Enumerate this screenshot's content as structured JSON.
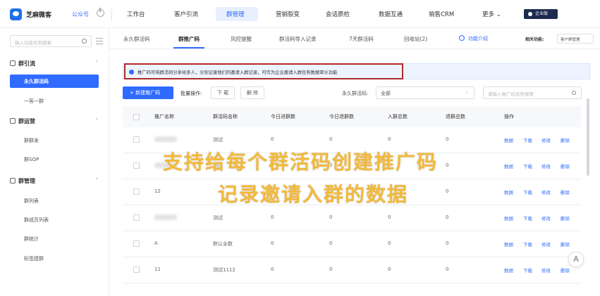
{
  "brand": {
    "name": "芝麻微客",
    "account": "公众号"
  },
  "topnav": {
    "items": [
      "工作台",
      "客户引流",
      "群管理",
      "营销裂变",
      "会话质检",
      "数据互通",
      "销售CRM",
      "更多 ⌄"
    ],
    "active_index": 2,
    "corp_badge": "企业版"
  },
  "sidebar": {
    "search_placeholder": "输入功能名称搜索",
    "groups": [
      {
        "label": "群引流",
        "items": [
          "永久群活码",
          "一客一群"
        ]
      },
      {
        "label": "群运营",
        "items": [
          "群群发",
          "群SOP"
        ]
      },
      {
        "label": "群管理",
        "items": [
          "群列表",
          "群成员列表",
          "群统计",
          "标签建群"
        ]
      }
    ],
    "active_item": "永久群活码"
  },
  "subtabs": {
    "items": [
      "永久群活码",
      "群推广码",
      "风控提醒",
      "群活码导入记录",
      "7天群活码",
      "回收站(2)"
    ],
    "active_index": 1,
    "help": "功能介绍",
    "related_label": "相关功能:",
    "related_value": "客户群管理"
  },
  "notice": "推广码可将群活码分享给多人，分别记录他们的邀请入群记录，可作为企业邀请入群任务数据审计功能",
  "toolbar": {
    "new_button": "+ 新建推广码",
    "batch_label": "批量操作:",
    "download": "下 载",
    "delete": "删 除",
    "filter_label": "永久群活码:",
    "filter_value": "全部",
    "search_placeholder": "请输入推广码名称搜索"
  },
  "table": {
    "headers": [
      "推广名称",
      "群活码名称",
      "今日进群数",
      "今日退群数",
      "入群总数",
      "退群总数",
      "操作"
    ],
    "ops": [
      "数据",
      "下载",
      "修改",
      "删除"
    ],
    "rows": [
      {
        "name": "",
        "code": "测试",
        "today_in": "0",
        "today_out": "0",
        "total_in": "0",
        "total_out": "0",
        "blurred": true
      },
      {
        "name": "",
        "code": "测试",
        "today_in": "0",
        "today_out": "0",
        "total_in": "0",
        "total_out": "0",
        "blurred": true
      },
      {
        "name": "12",
        "code": "",
        "today_in": "",
        "today_out": "",
        "total_in": "",
        "total_out": "0",
        "blurred": false
      },
      {
        "name": "",
        "code": "测试",
        "today_in": "0",
        "today_out": "0",
        "total_in": "0",
        "total_out": "0",
        "blurred": true
      },
      {
        "name": "A",
        "code": "默认全数",
        "today_in": "0",
        "today_out": "0",
        "total_in": "0",
        "total_out": "0",
        "blurred": false
      },
      {
        "name": "11",
        "code": "测试1112",
        "today_in": "0",
        "today_out": "0",
        "total_in": "0",
        "total_out": "0",
        "blurred": false
      }
    ]
  },
  "overlay": {
    "line1": "支持给每个群活码创建推广码",
    "line2": "记录邀请入群的数据"
  },
  "float_button": "A",
  "colors": {
    "accent": "#2f6bff",
    "overlay_text": "#f2b93b",
    "highlight_box": "#b02a2a"
  }
}
